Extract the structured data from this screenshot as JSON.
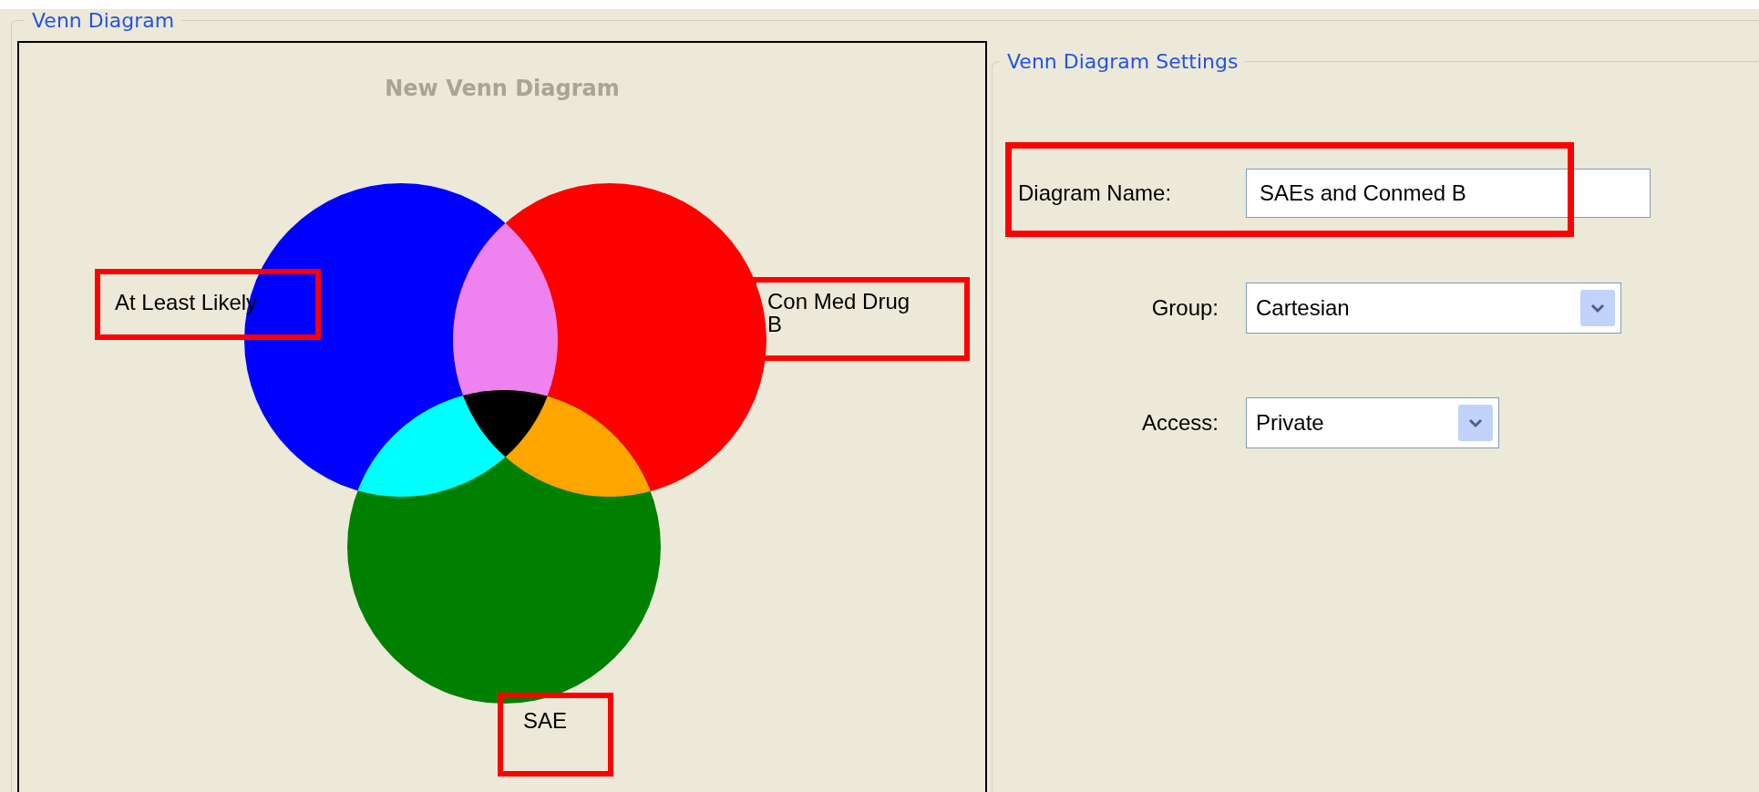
{
  "panel": {
    "title": "Venn Diagram"
  },
  "diagram": {
    "title": "New Venn Diagram",
    "sets": [
      {
        "label": "At Least Likely",
        "color": "#0000ff",
        "highlighted": true
      },
      {
        "label": "Con Med Drug B",
        "color": "#ff0000",
        "highlighted": true
      },
      {
        "label": "SAE",
        "color": "#008000",
        "highlighted": true
      }
    ],
    "overlaps": [
      {
        "color": "#ee82ee"
      },
      {
        "color": "#00ffff"
      },
      {
        "color": "#ffa500"
      },
      {
        "color": "#000000"
      }
    ]
  },
  "settings": {
    "title": "Venn Diagram Settings",
    "fields": [
      {
        "kind": "text",
        "label": "Diagram Name:",
        "value": "SAEs and Conmed B",
        "highlighted": true
      },
      {
        "kind": "dropdown",
        "label": "Group:",
        "value": "Cartesian",
        "highlighted": false
      },
      {
        "kind": "dropdown",
        "label": "Access:",
        "value": "Private",
        "highlighted": false
      }
    ]
  }
}
